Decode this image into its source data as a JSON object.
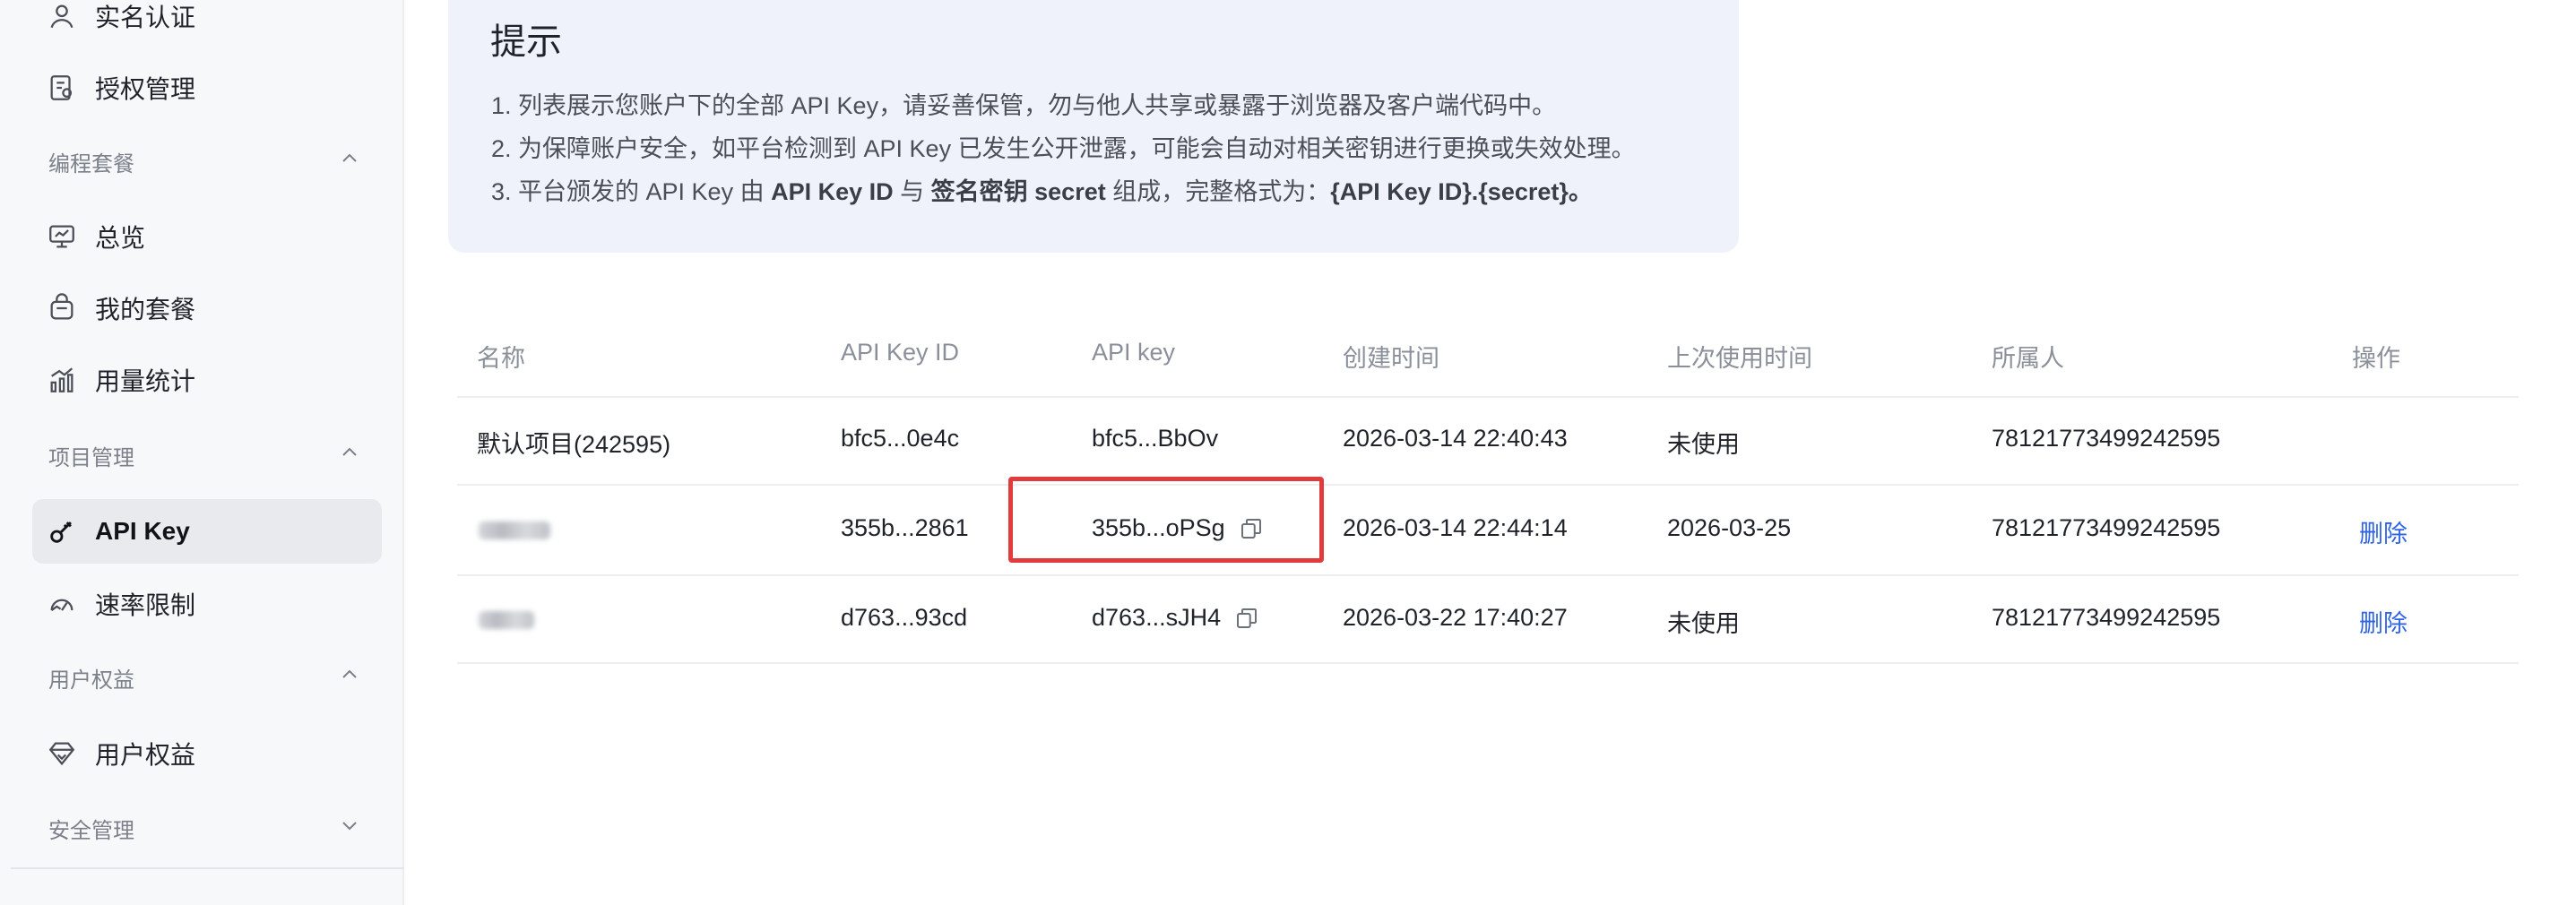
{
  "sidebar": {
    "items": [
      {
        "label": "实名认证",
        "icon": "user-icon"
      },
      {
        "label": "授权管理",
        "icon": "document-icon"
      },
      {
        "label": "总览",
        "icon": "monitor-icon"
      },
      {
        "label": "我的套餐",
        "icon": "bag-icon"
      },
      {
        "label": "用量统计",
        "icon": "chart-icon"
      },
      {
        "label": "API Key",
        "icon": "key-icon",
        "active": true
      },
      {
        "label": "速率限制",
        "icon": "gauge-icon"
      },
      {
        "label": "用户权益",
        "icon": "diamond-icon"
      }
    ],
    "groups": [
      {
        "label": "编程套餐",
        "state": "expanded"
      },
      {
        "label": "项目管理",
        "state": "expanded"
      },
      {
        "label": "用户权益",
        "state": "expanded"
      },
      {
        "label": "安全管理",
        "state": "collapsed"
      }
    ]
  },
  "tip": {
    "title": "提示",
    "line1": "1. 列表展示您账户下的全部 API Key，请妥善保管，勿与他人共享或暴露于浏览器及客户端代码中。",
    "line2": "2. 为保障账户安全，如平台检测到 API Key 已发生公开泄露，可能会自动对相关密钥进行更换或失效处理。",
    "line3_a": "3. 平台颁发的 API Key 由 ",
    "line3_b": "API Key ID",
    "line3_c": " 与 ",
    "line3_d": "签名密钥 secret",
    "line3_e": " 组成，完整格式为：",
    "line3_f": "{API Key ID}.{secret}。"
  },
  "table": {
    "headers": [
      "名称",
      "API Key ID",
      "API key",
      "创建时间",
      "上次使用时间",
      "所属人",
      "操作"
    ],
    "rows": [
      {
        "name": "默认项目(242595)",
        "key_id": "bfc5...0e4c",
        "api_key": "bfc5...BbOv",
        "created": "2026-03-14 22:40:43",
        "last_used": "未使用",
        "owner": "78121773499242595",
        "action": ""
      },
      {
        "name": "",
        "key_id": "355b...2861",
        "api_key": "355b...oPSg",
        "created": "2026-03-14 22:44:14",
        "last_used": "2026-03-25",
        "owner": "78121773499242595",
        "action": "删除"
      },
      {
        "name": "",
        "key_id": "d763...93cd",
        "api_key": "d763...sJH4",
        "created": "2026-03-22 17:40:27",
        "last_used": "未使用",
        "owner": "78121773499242595",
        "action": "删除"
      }
    ]
  },
  "colors": {
    "accent": "#2f64e8",
    "highlight": "#e23b3b",
    "tip_bg": "#f0f2fb",
    "sidebar_bg": "#f7f8fa"
  }
}
